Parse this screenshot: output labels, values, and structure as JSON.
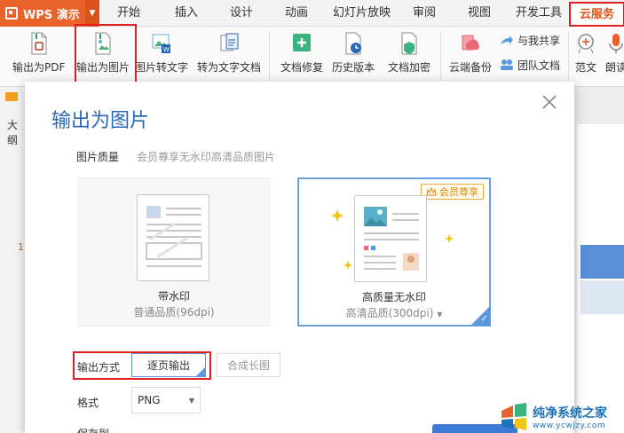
{
  "app": {
    "name": "WPS 演示"
  },
  "tabs": [
    "开始",
    "插入",
    "设计",
    "动画",
    "幻灯片放映",
    "审阅",
    "视图",
    "开发工具",
    "云服务"
  ],
  "ribbon": {
    "export_pdf": "输出为PDF",
    "export_image": "输出为图片",
    "image_to_text": "图片转文字",
    "to_document": "转为文字文档",
    "doc_repair": "文档修复",
    "history": "历史版本",
    "encrypt": "文档加密",
    "cloud_backup": "云端备份",
    "shared_with_me": "与我共享",
    "team_docs": "团队文档",
    "templates": "范文",
    "read_aloud": "朗读"
  },
  "left_pane": {
    "label": "大纲",
    "slide_number": "1"
  },
  "dialog": {
    "title": "输出为图片",
    "quality_label": "图片质量",
    "quality_hint": "会员尊享无水印高清品质图片",
    "options": [
      {
        "title": "带水印",
        "subtitle": "普通品质(96dpi)",
        "selected": false
      },
      {
        "title": "高质量无水印",
        "subtitle": "高清品质(300dpi)",
        "selected": true,
        "badge": "会员尊享"
      }
    ],
    "mode_label": "输出方式",
    "modes": [
      "逐页输出",
      "合成长图"
    ],
    "format_label": "格式",
    "format_value": "PNG",
    "save_to_label": "保存到"
  },
  "watermark": {
    "line1": "纯净系统之家",
    "line2": "www.ycwjzy.com"
  },
  "colors": {
    "accent": "#2b67b7",
    "brand_orange": "#e8622c",
    "highlight_red": "#e02020",
    "selected_blue": "#5c97dd"
  }
}
